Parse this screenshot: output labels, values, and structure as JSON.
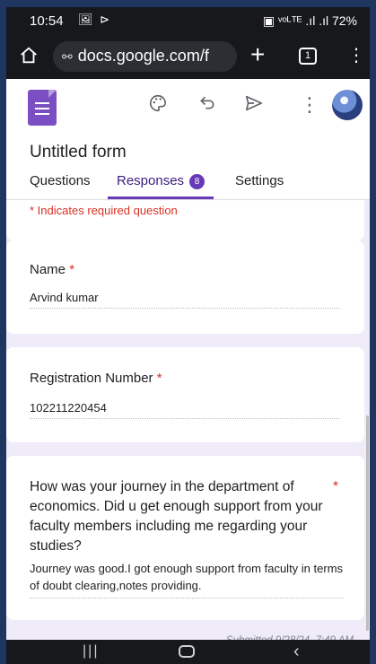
{
  "status": {
    "time": "10:54",
    "notif_icons": "🖼 ⊳",
    "right": "▣ ᵛᵒᴸᵀᴱ .ıl .ıl 72%"
  },
  "browser": {
    "url": "docs.google.com/f",
    "tabs_count": "1"
  },
  "form": {
    "title": "Untitled form",
    "tabs": [
      {
        "label": "Questions"
      },
      {
        "label": "Responses",
        "badge": "8"
      },
      {
        "label": "Settings"
      }
    ],
    "required_note": "* Indicates required question"
  },
  "questions": [
    {
      "label": "Name",
      "required": "*",
      "answer": "Arvind kumar"
    },
    {
      "label": "Registration Number",
      "required": "*",
      "answer": "102211220454"
    },
    {
      "label": "How was your journey in the department of economics. Did u get enough support from your faculty members including me regarding your studies?",
      "required": "*",
      "answer": "Journey was good.I got enough support from faculty in terms of doubt clearing,notes providing."
    }
  ],
  "submitted": "Submitted 9/28/24, 7:49 AM",
  "icons": [
    "home-icon",
    "site-settings-icon",
    "plus-icon",
    "tabs-icon",
    "more-vert-icon",
    "palette-icon",
    "undo-icon",
    "send-icon",
    "recent-apps-icon",
    "nav-home-icon",
    "nav-back-icon"
  ],
  "colors": {
    "accent": "#673ab7",
    "required": "#d93025",
    "form_bg": "#f0ebf8"
  }
}
